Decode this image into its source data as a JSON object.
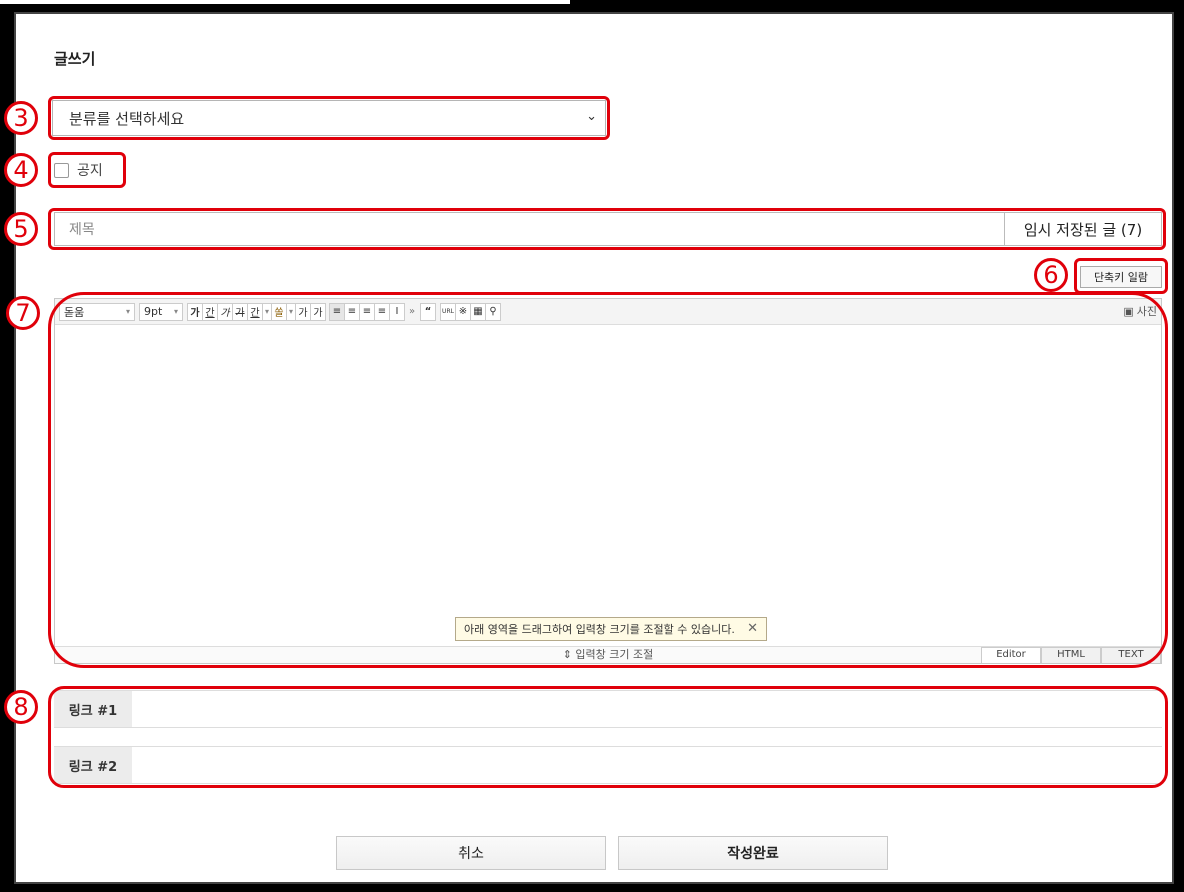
{
  "page": {
    "title": "글쓰기"
  },
  "category": {
    "placeholder": "분류를 선택하세요"
  },
  "notice": {
    "label": "공지",
    "checked": false
  },
  "subject": {
    "placeholder": "제목",
    "temp_saved_label": "임시 저장된 글 (7)"
  },
  "shortcut_button": "단축키 일람",
  "editor": {
    "font": "돋움",
    "size": "9pt",
    "format_buttons": [
      "가",
      "간",
      "가",
      "가",
      "간",
      "쏠",
      "가",
      "가"
    ],
    "photo_label": "사진",
    "tooltip": "아래 영역을 드래그하여 입력창 크기를 조절할 수 있습니다.",
    "resize_label": "⇕ 입력창 크기 조절",
    "modes": [
      "Editor",
      "HTML",
      "TEXT"
    ]
  },
  "links": [
    {
      "label": "링크 #1",
      "value": ""
    },
    {
      "label": "링크 #2",
      "value": ""
    }
  ],
  "buttons": {
    "cancel": "취소",
    "submit": "작성완료"
  },
  "annotations": [
    "3",
    "4",
    "5",
    "6",
    "7",
    "8"
  ],
  "colors": {
    "highlight": "#e0000a",
    "background": "#ffffff"
  }
}
